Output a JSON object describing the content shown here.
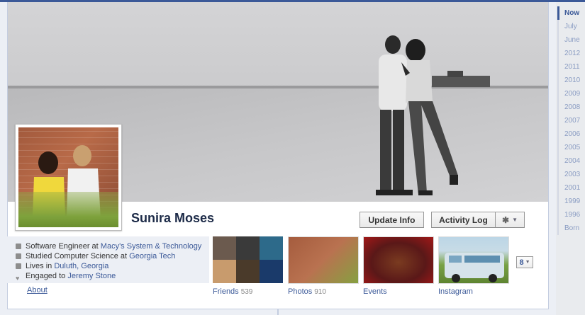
{
  "profile": {
    "name": "Sunira Moses"
  },
  "actions": {
    "update_info": "Update Info",
    "activity_log": "Activity Log",
    "gear_glyph": "✱",
    "caret_glyph": "▼"
  },
  "info": {
    "work_prefix": "Software Engineer at",
    "work_link": "Macy's System & Technology",
    "study_prefix": "Studied Computer Science at",
    "study_link": "Georgia Tech",
    "lives_prefix": "Lives in",
    "lives_link": "Duluth, Georgia",
    "engaged_prefix": "Engaged to",
    "engaged_link": "Jeremy Stone",
    "about_label": "About"
  },
  "apps": [
    {
      "label": "Friends",
      "count": "539"
    },
    {
      "label": "Photos",
      "count": "910"
    },
    {
      "label": "Events",
      "count": ""
    },
    {
      "label": "Instagram",
      "count": ""
    }
  ],
  "more_apps": {
    "count": "8",
    "caret": "▼"
  },
  "timeline_nav": [
    "Now",
    "July",
    "June",
    "2012",
    "2011",
    "2010",
    "2009",
    "2008",
    "2007",
    "2006",
    "2005",
    "2004",
    "2003",
    "2001",
    "1999",
    "1996",
    "Born"
  ],
  "colors": {
    "brand": "#3b5998",
    "link": "#3b5998",
    "name": "#1c2a47",
    "nav_inactive": "#8b9dc3"
  },
  "icons": {
    "work": "briefcase-icon",
    "study": "graduation-cap-icon",
    "lives": "house-icon",
    "engaged": "heart-icon",
    "gear": "gear-icon"
  }
}
